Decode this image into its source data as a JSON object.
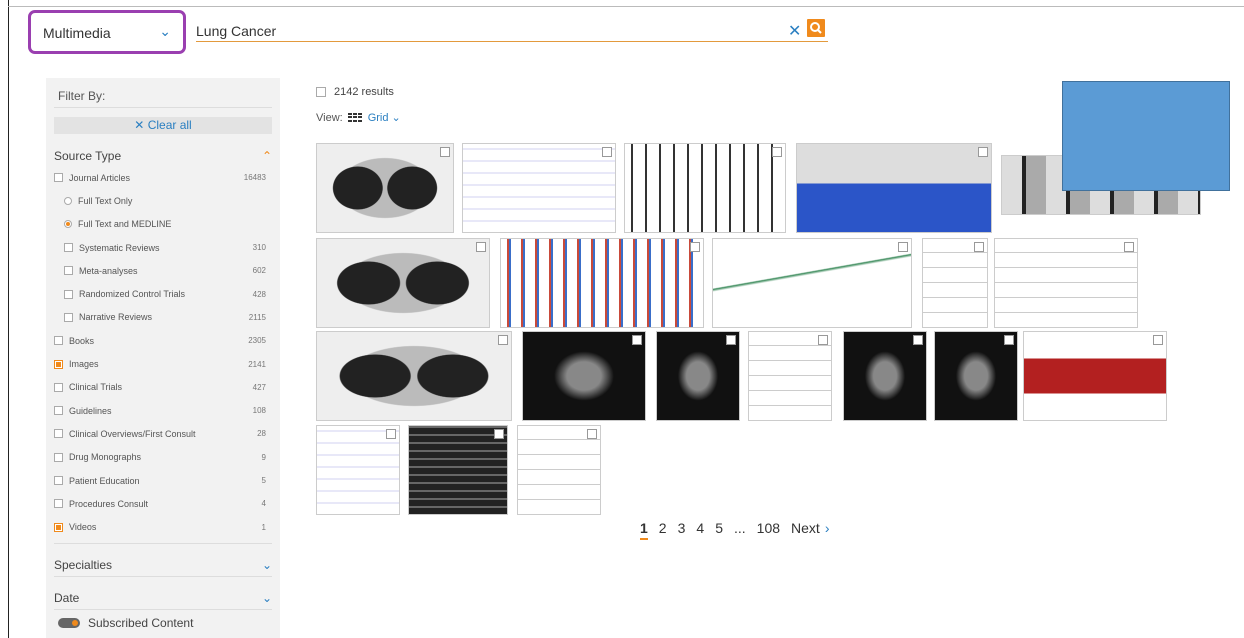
{
  "search": {
    "category": "Multimedia",
    "query": "Lung Cancer"
  },
  "sidebar": {
    "filter_by": "Filter By:",
    "clear_all": "Clear all",
    "source_type_title": "Source Type",
    "items": [
      {
        "label": "Journal Articles",
        "count": "16483",
        "kind": "checkbox",
        "checked": false,
        "indent": 0
      },
      {
        "label": "Full Text Only",
        "count": "",
        "kind": "radio",
        "checked": false,
        "indent": 1
      },
      {
        "label": "Full Text and MEDLINE",
        "count": "",
        "kind": "radio",
        "checked": true,
        "indent": 1
      },
      {
        "label": "Systematic Reviews",
        "count": "310",
        "kind": "checkbox",
        "checked": false,
        "indent": 1
      },
      {
        "label": "Meta-analyses",
        "count": "602",
        "kind": "checkbox",
        "checked": false,
        "indent": 1
      },
      {
        "label": "Randomized Control Trials",
        "count": "428",
        "kind": "checkbox",
        "checked": false,
        "indent": 1
      },
      {
        "label": "Narrative Reviews",
        "count": "2115",
        "kind": "checkbox",
        "checked": false,
        "indent": 1
      },
      {
        "label": "Books",
        "count": "2305",
        "kind": "checkbox",
        "checked": false,
        "indent": 0
      },
      {
        "label": "Images",
        "count": "2141",
        "kind": "checkbox",
        "checked": true,
        "indent": 0
      },
      {
        "label": "Clinical Trials",
        "count": "427",
        "kind": "checkbox",
        "checked": false,
        "indent": 0
      },
      {
        "label": "Guidelines",
        "count": "108",
        "kind": "checkbox",
        "checked": false,
        "indent": 0
      },
      {
        "label": "Clinical Overviews/First Consult",
        "count": "28",
        "kind": "checkbox",
        "checked": false,
        "indent": 0
      },
      {
        "label": "Drug Monographs",
        "count": "9",
        "kind": "checkbox",
        "checked": false,
        "indent": 0
      },
      {
        "label": "Patient Education",
        "count": "5",
        "kind": "checkbox",
        "checked": false,
        "indent": 0
      },
      {
        "label": "Procedures Consult",
        "count": "4",
        "kind": "checkbox",
        "checked": false,
        "indent": 0
      },
      {
        "label": "Videos",
        "count": "1",
        "kind": "checkbox",
        "checked": true,
        "indent": 0
      }
    ],
    "specialties_title": "Specialties",
    "date_title": "Date",
    "subscribed_label": "Subscribed Content"
  },
  "results": {
    "count_text": "2142 results",
    "view_label": "View:",
    "view_mode": "Grid"
  },
  "pagination": {
    "pages": [
      "1",
      "2",
      "3",
      "4",
      "5",
      "...",
      "108"
    ],
    "current": "1",
    "next_label": "Next"
  },
  "colors": {
    "accent_orange": "#f08a1c",
    "link_blue": "#2a7fc1",
    "highlight_purple": "#9a3fb0",
    "redaction_blue": "#5b9bd5"
  }
}
